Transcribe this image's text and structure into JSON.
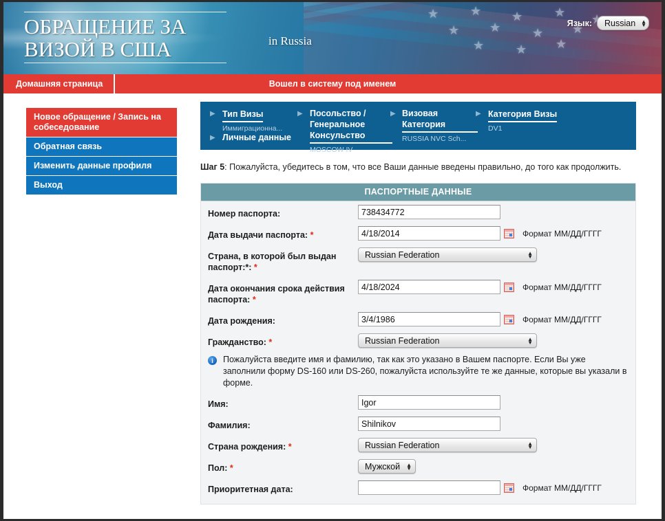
{
  "header": {
    "title": "ОБРАЩЕНИЕ ЗА\nВИЗОЙ В США",
    "in_country": "in  Russia",
    "language_label": "Язык:",
    "language_value": "Russian"
  },
  "navbar": {
    "home": "Домашняя страница",
    "logged_in": "Вошел в систему под именем"
  },
  "sidebar": {
    "items": [
      {
        "label": "Новое обращение / Запись на собеседование",
        "active": true
      },
      {
        "label": "Обратная связь",
        "active": false
      },
      {
        "label": "Изменить данные профиля",
        "active": false
      },
      {
        "label": "Выход",
        "active": false
      }
    ]
  },
  "steps": [
    {
      "title": "Тип Визы",
      "sub": "Иммиграционна..."
    },
    {
      "title": "Посольство / Генеральное Консульство",
      "sub": "MOSCOW IV"
    },
    {
      "title": "Визовая Категория",
      "sub": "RUSSIA NVC Sch..."
    },
    {
      "title": "Категория Визы",
      "sub": "DV1"
    }
  ],
  "steps_second_row": "Личные данные",
  "step_note": {
    "prefix": "Шаг 5",
    "text": ": Пожалуйста, убедитесь в том, что все Ваши данные введены правильно, до того как продолжить."
  },
  "form": {
    "heading": "ПАСПОРТНЫЕ ДАННЫЕ",
    "date_format": "Формат ММ/ДД/ГГГГ",
    "info_message": "Пожалуйста введите имя и фамилию, так как это указано в Вашем паспорте. Если Вы уже заполнили форму DS-160 или DS-260, пожалуйста используйте те же данные, которые вы указали в форме.",
    "fields": {
      "passport_number": {
        "label": "Номер паспорта:",
        "value": "738434772"
      },
      "issue_date": {
        "label": "Дата выдачи паспорта:",
        "value": "4/18/2014"
      },
      "issue_country": {
        "label": "Страна, в которой был выдан паспорт:*:",
        "value": "Russian Federation"
      },
      "expiry_date": {
        "label": "Дата окончания срока действия паспорта:",
        "value": "4/18/2024"
      },
      "birth_date": {
        "label": "Дата рождения:",
        "value": "3/4/1986"
      },
      "citizenship": {
        "label": "Гражданство:",
        "value": "Russian Federation"
      },
      "first_name": {
        "label": "Имя:",
        "value": "Igor"
      },
      "last_name": {
        "label": "Фамилия:",
        "value": "Shilnikov"
      },
      "birth_country": {
        "label": "Страна рождения:",
        "value": "Russian Federation"
      },
      "gender": {
        "label": "Пол:",
        "value": "Мужской"
      },
      "priority_date": {
        "label": "Приоритетная дата:",
        "value": ""
      }
    }
  },
  "colors": {
    "red": "#e23b33",
    "blue": "#0f75bc",
    "steps_blue": "#0e5f92",
    "teal": "#6b9ba4",
    "required": "#e12a18"
  }
}
